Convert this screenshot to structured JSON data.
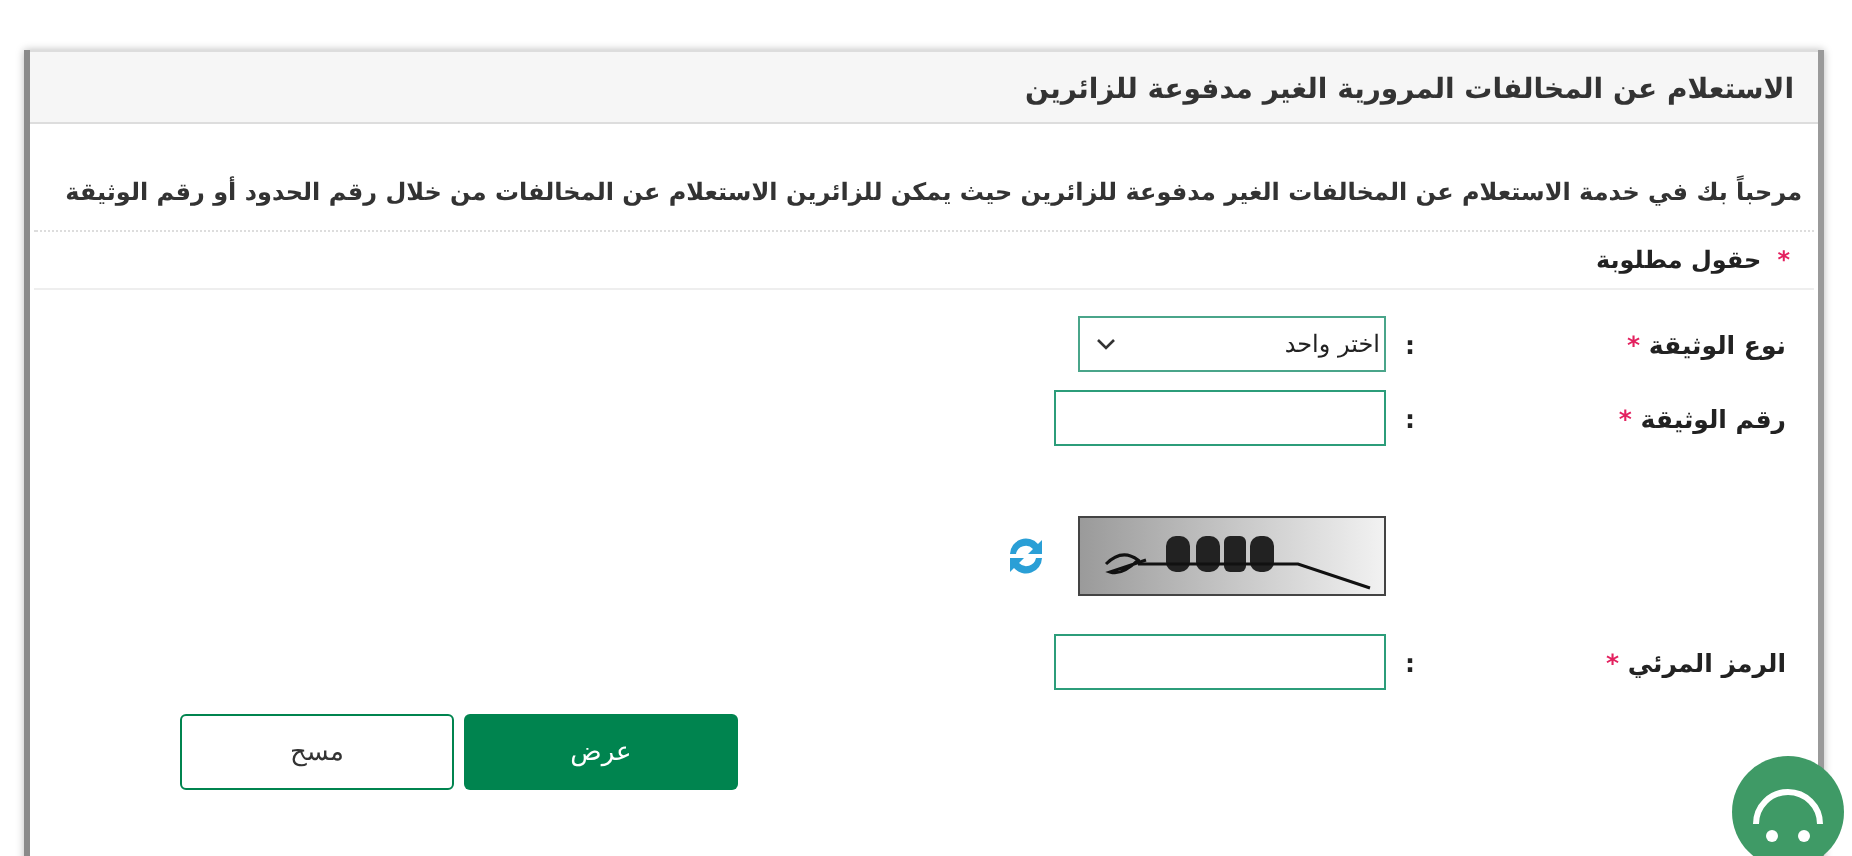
{
  "panel": {
    "title": "الاستعلام عن المخالفات المرورية الغير مدفوعة للزائرين",
    "intro": "مرحباً بك في خدمة الاستعلام عن المخالفات الغير مدفوعة للزائرين حيث يمكن للزائرين الاستعلام عن المخالفات من خلال رقم الحدود أو رقم الوثيقة",
    "required_note": {
      "mark": "*",
      "text": "حقول مطلوبة"
    }
  },
  "fields": [
    {
      "kind": "select",
      "label": "نوع الوثيقة",
      "mark": "*",
      "separator": ":",
      "value": "اختر واحد"
    },
    {
      "kind": "text",
      "label": "رقم الوثيقة",
      "mark": "*",
      "separator": ":"
    },
    {
      "kind": "captcha"
    },
    {
      "kind": "text",
      "label": "الرمز المرئي",
      "mark": "*",
      "separator": ":"
    }
  ],
  "buttons": [
    {
      "label": "عرض",
      "kind": "primary"
    },
    {
      "label": "مسح",
      "kind": "secondary"
    }
  ]
}
